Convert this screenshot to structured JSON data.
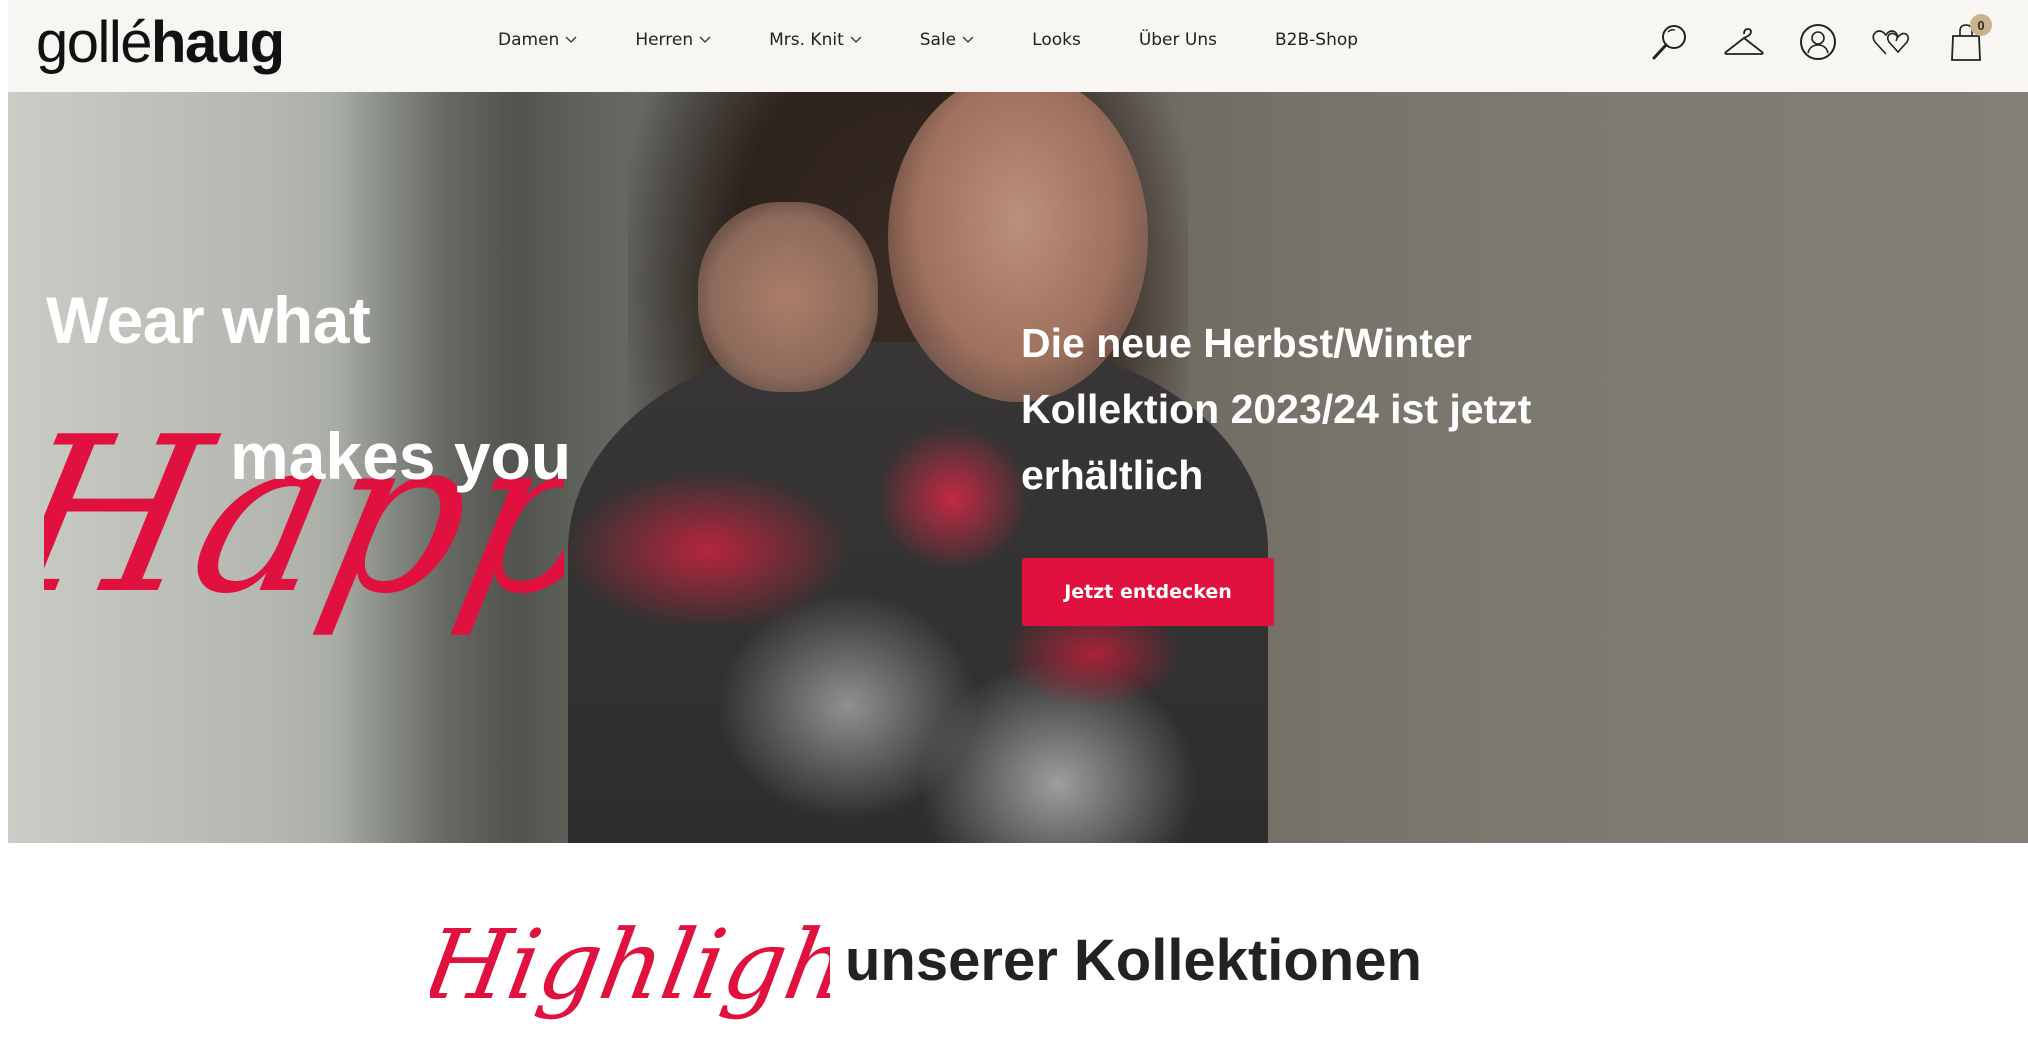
{
  "brand": {
    "logo_light": "gollé",
    "logo_bold": "haug"
  },
  "nav": {
    "items": [
      {
        "label": "Damen",
        "dropdown": true
      },
      {
        "label": "Herren",
        "dropdown": true
      },
      {
        "label": "Mrs. Knit",
        "dropdown": true
      },
      {
        "label": "Sale",
        "dropdown": true
      },
      {
        "label": "Looks",
        "dropdown": false
      },
      {
        "label": "Über Uns",
        "dropdown": false
      },
      {
        "label": "B2B-Shop",
        "dropdown": false
      }
    ]
  },
  "header_icons": {
    "search": "search-icon",
    "wardrobe": "hanger-icon",
    "account": "user-icon",
    "wishlist": "hearts-icon",
    "cart": "shopping-bag-icon",
    "cart_count": "0"
  },
  "hero": {
    "line1": "Wear what",
    "script_word": "Happy",
    "line2": "makes you",
    "headline": "Die neue Herbst/Winter Kollektion 2023/24 ist jetzt erhältlich",
    "cta_label": "Jetzt entdecken",
    "accent_color": "#e0113e"
  },
  "highlights": {
    "script_word": "Highlights",
    "heading": "unserer Kollektionen"
  }
}
